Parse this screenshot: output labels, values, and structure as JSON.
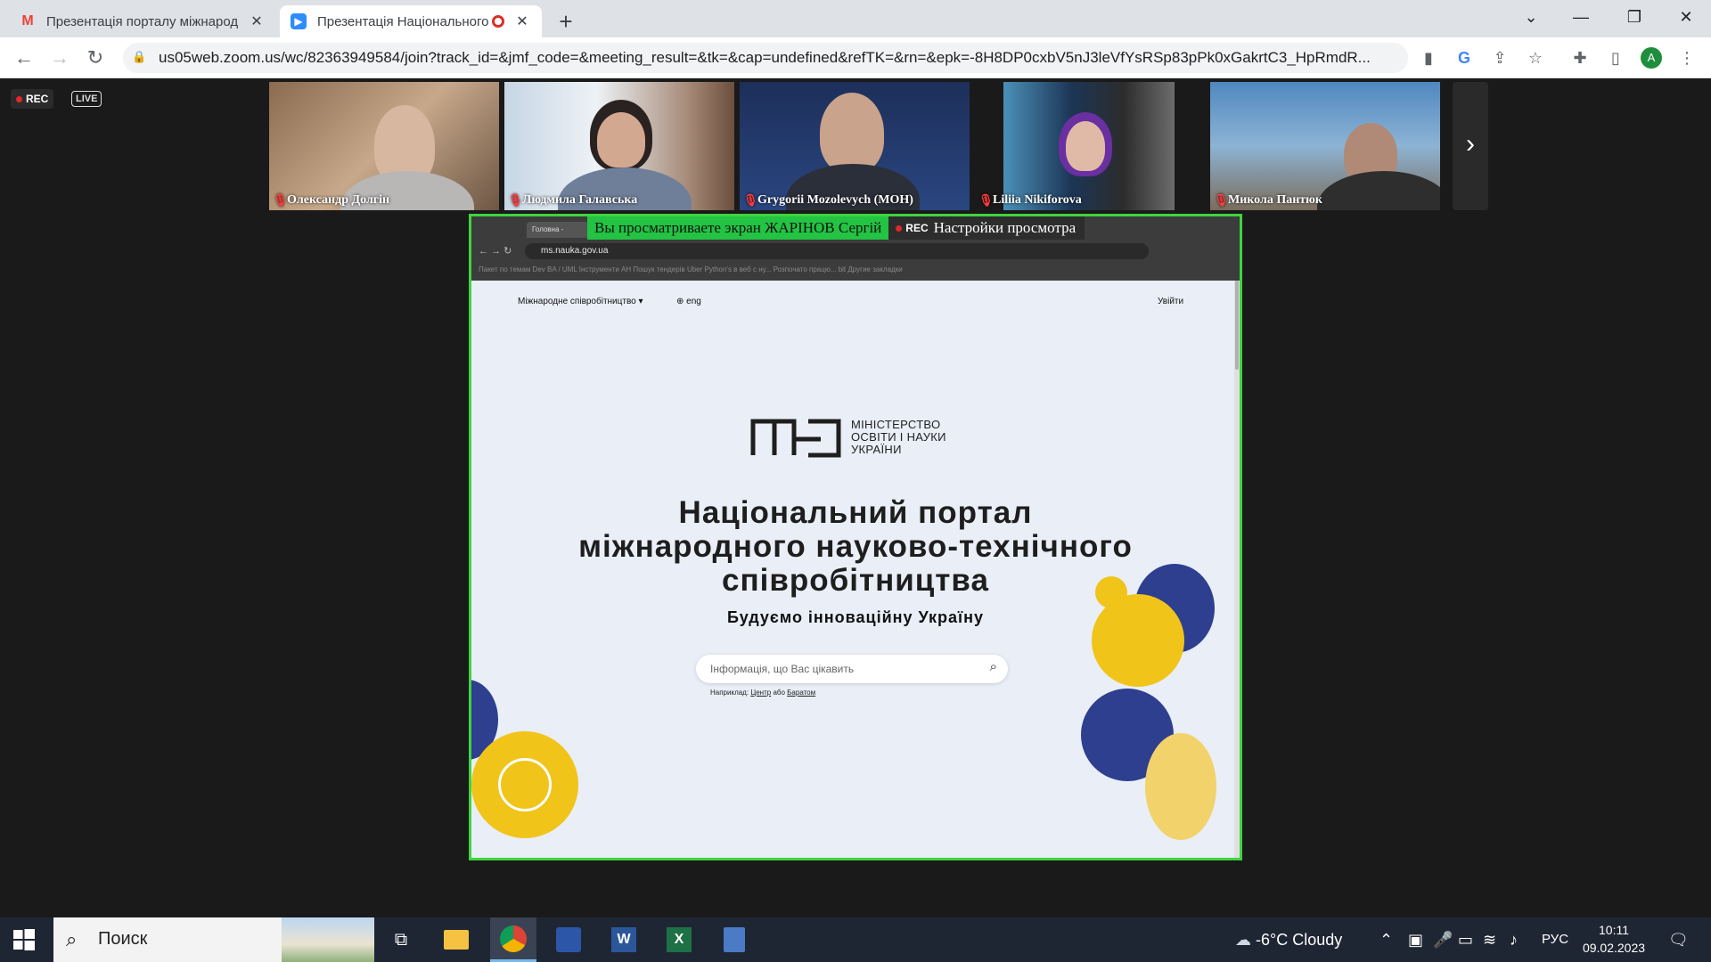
{
  "browser": {
    "tabs": [
      {
        "title": "Презентація порталу міжнарод",
        "favicon": "gmail-icon",
        "close": "✕"
      },
      {
        "title": "Презентація Національного",
        "favicon": "zoom-icon",
        "close": "✕"
      }
    ],
    "new_tab": "+",
    "url": "us05web.zoom.us/wc/82363949584/join?track_id=&jmf_code=&meeting_result=&tk=&cap=undefined&refTK=&rn=&epk=-8H8DP0cxbV5nJ3leVfYsRSp83pPk0xGakrtC3_HpRmdR...",
    "profile_initial": "A"
  },
  "meeting": {
    "rec_label": "REC",
    "live_label": "LIVE",
    "participants": [
      {
        "name": "Олександр Долгін"
      },
      {
        "name": "Людмила Галавська"
      },
      {
        "name": "Grygorii Mozolevych (МОН)"
      },
      {
        "name": "Liliia Nikiforova"
      },
      {
        "name": "Микола Пантюк"
      }
    ],
    "share_banner": {
      "message": "Вы просматриваете экран ЖАРІНОВ Сергій",
      "rec": "REC",
      "settings": "Настройки просмотра"
    }
  },
  "shared_screen": {
    "inner_tab": "Головна -",
    "inner_url": "ms.nauka.gov.ua",
    "bookmarks": "Пакет по темам   Dev   BA / UML   Інструменти   AH   Пошук тендерів   Uber   Python's в веб с ну...   Розпочато працю...   bit         Другие закладки",
    "nav_menu": "Міжнародне співробітництво ▾",
    "nav_lang": "eng",
    "nav_login": "Увійти",
    "logo_text": [
      "МІНІСТЕРСТВО",
      "ОСВІТИ І НАУКИ",
      "УКРАЇНИ"
    ],
    "headline": [
      "Національний портал",
      "міжнародного науково-технічного",
      "співробітництва"
    ],
    "subline": "Будуємо інноваційну Україну",
    "search_placeholder": "Інформація, що Вас цікавить",
    "hint_prefix": "Наприклад:",
    "hint_link1": "Центр",
    "hint_mid": "або",
    "hint_link2": "Баратом"
  },
  "taskbar": {
    "search_label": "Поиск",
    "weather": "-6°C  Cloudy",
    "lang": "РУС",
    "time": "10:11",
    "date": "09.02.2023"
  }
}
